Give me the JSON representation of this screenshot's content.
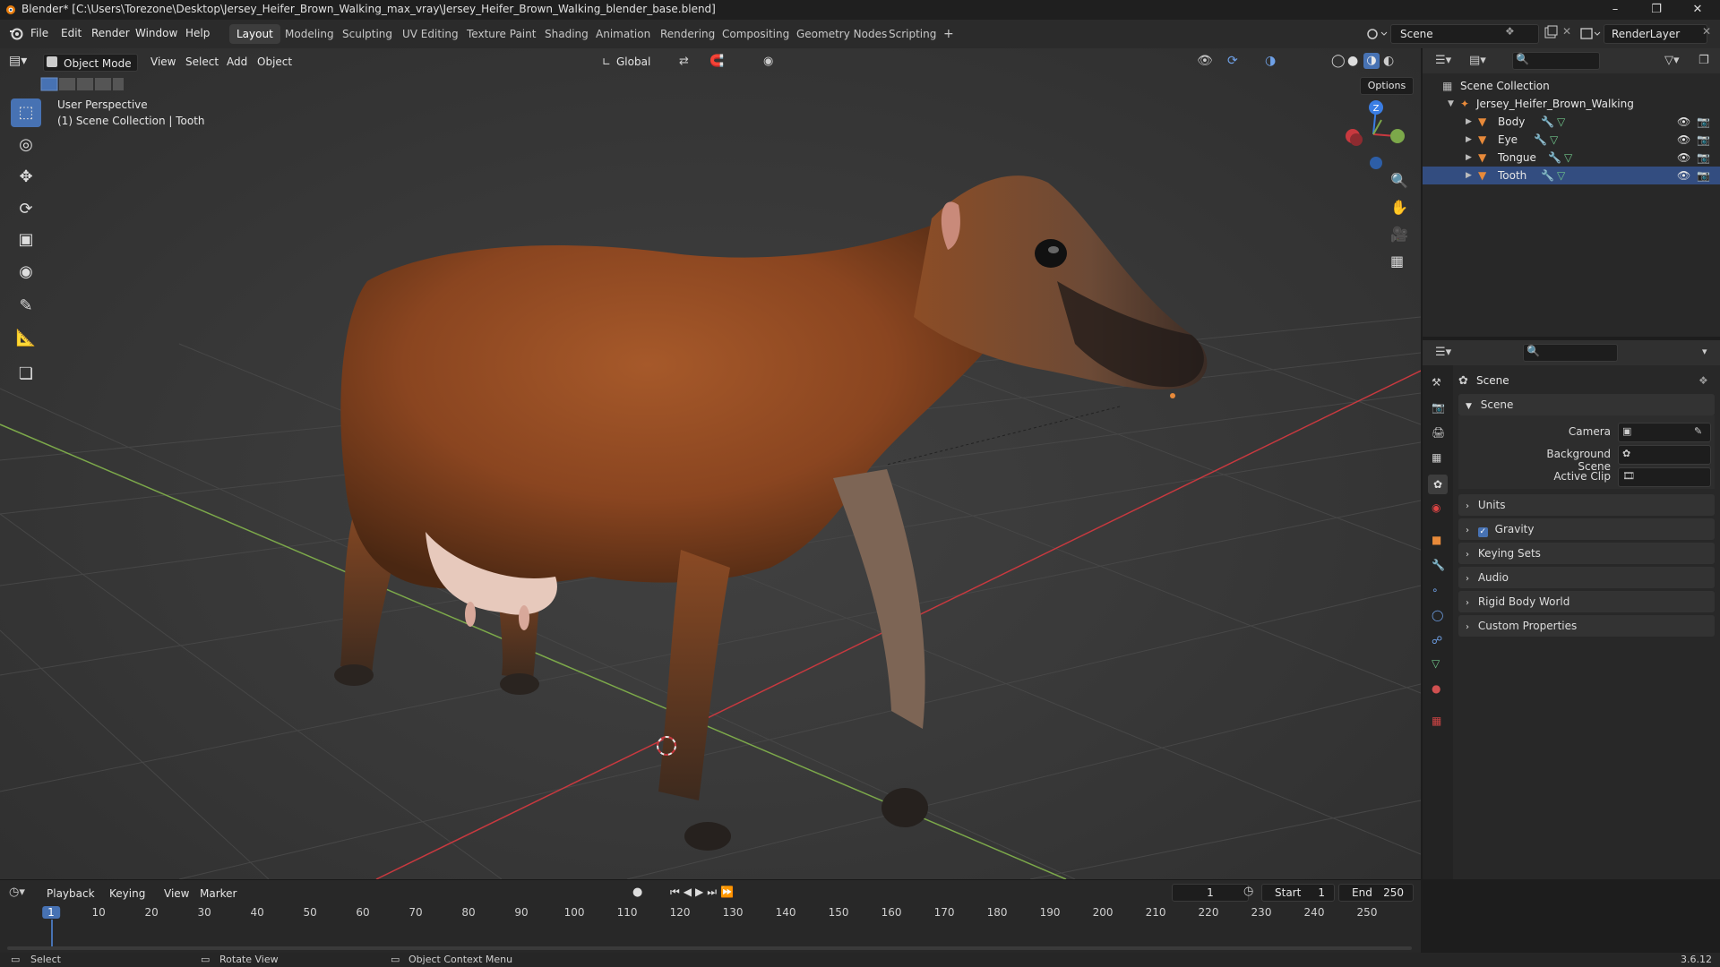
{
  "window": {
    "title": "Blender* [C:\\Users\\Torezone\\Desktop\\Jersey_Heifer_Brown_Walking_max_vray\\Jersey_Heifer_Brown_Walking_blender_base.blend]",
    "min_icon": "minimize-icon",
    "max_icon": "maximize-icon",
    "close_icon": "close-icon"
  },
  "menu": [
    "File",
    "Edit",
    "Render",
    "Window",
    "Help"
  ],
  "workspaces": [
    "Layout",
    "Modeling",
    "Sculpting",
    "UV Editing",
    "Texture Paint",
    "Shading",
    "Animation",
    "Rendering",
    "Compositing",
    "Geometry Nodes",
    "Scripting",
    "+"
  ],
  "active_workspace": "Layout",
  "scene_selector": {
    "value": "Scene",
    "render_layer": "RenderLayer"
  },
  "viewport_header": {
    "mode": "Object Mode",
    "menus": [
      "View",
      "Select",
      "Add",
      "Object"
    ],
    "transform_orientation": "Global",
    "options_label": "Options"
  },
  "viewport": {
    "perspective_label": "User Perspective",
    "context_label": "(1) Scene Collection | Tooth",
    "gizmo_z": "Z"
  },
  "outliner": {
    "root": "Scene Collection",
    "object": "Jersey_Heifer_Brown_Walking",
    "children": [
      "Body",
      "Eye",
      "Tongue",
      "Tooth"
    ]
  },
  "properties": {
    "header": "Scene",
    "panel_title": "Scene",
    "fields": {
      "camera": "Camera",
      "background_scene": "Background Scene",
      "active_clip": "Active Clip"
    },
    "sections": [
      "Units",
      "Gravity",
      "Keying Sets",
      "Audio",
      "Rigid Body World",
      "Custom Properties"
    ],
    "gravity_checked": true
  },
  "timeline": {
    "menus": [
      "Playback",
      "Keying",
      "View",
      "Marker"
    ],
    "current_frame": "1",
    "start_label": "Start",
    "start": "1",
    "end_label": "End",
    "end": "250",
    "ticks": [
      "1",
      "10",
      "20",
      "30",
      "40",
      "50",
      "60",
      "70",
      "80",
      "90",
      "100",
      "110",
      "120",
      "130",
      "140",
      "150",
      "160",
      "170",
      "180",
      "190",
      "200",
      "210",
      "220",
      "230",
      "240",
      "250"
    ]
  },
  "statusbar": {
    "select": "Select",
    "rotate": "Rotate View",
    "context_menu": "Object Context Menu",
    "version": "3.6.12"
  },
  "colors": {
    "accent": "#4772b3",
    "x_axis": "#c8393f",
    "y_axis": "#7ca84a",
    "z_axis": "#3a7de3",
    "orange": "#e88a3a"
  }
}
